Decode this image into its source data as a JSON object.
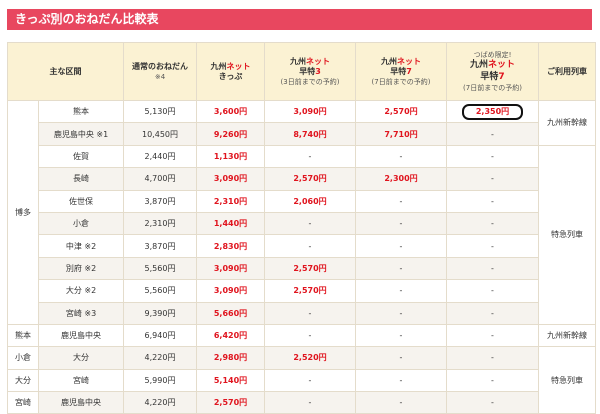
{
  "title": "きっぷ別のおねだん比較表",
  "header": {
    "section": "主な区間",
    "normal": [
      "通常のおねだん",
      "※4"
    ],
    "kyushu_net": [
      "九州",
      "ネット",
      "きっぷ"
    ],
    "haya3": [
      "九州",
      "ネット",
      "早特",
      "3",
      "(3日前までの予約)"
    ],
    "haya7": [
      "九州",
      "ネット",
      "早特",
      "7",
      "(7日前までの予約)"
    ],
    "tsubame": [
      "つばめ限定!",
      "九州",
      "ネット",
      "早特",
      "7",
      "(7日前までの予約)"
    ],
    "train": "ご利用列車"
  },
  "origins": [
    "博多",
    "熊本",
    "小倉",
    "大分",
    "宮崎"
  ],
  "lines": [
    "九州新幹線",
    "特急列車",
    "九州新幹線",
    "特急列車"
  ],
  "rows": [
    {
      "dest": "熊本",
      "normal": "5,130円",
      "net": "3,600円",
      "h3": "3,090円",
      "h7": "2,570円",
      "tsubame": "2,350円"
    },
    {
      "dest": "鹿児島中央 ※1",
      "normal": "10,450円",
      "net": "9,260円",
      "h3": "8,740円",
      "h7": "7,710円",
      "tsubame": "-"
    },
    {
      "dest": "佐賀",
      "normal": "2,440円",
      "net": "1,130円",
      "h3": "-",
      "h7": "-",
      "tsubame": "-"
    },
    {
      "dest": "長崎",
      "normal": "4,700円",
      "net": "3,090円",
      "h3": "2,570円",
      "h7": "2,300円",
      "tsubame": "-"
    },
    {
      "dest": "佐世保",
      "normal": "3,870円",
      "net": "2,310円",
      "h3": "2,060円",
      "h7": "-",
      "tsubame": "-"
    },
    {
      "dest": "小倉",
      "normal": "2,310円",
      "net": "1,440円",
      "h3": "-",
      "h7": "-",
      "tsubame": "-"
    },
    {
      "dest": "中津 ※2",
      "normal": "3,870円",
      "net": "2,830円",
      "h3": "-",
      "h7": "-",
      "tsubame": "-"
    },
    {
      "dest": "別府 ※2",
      "normal": "5,560円",
      "net": "3,090円",
      "h3": "2,570円",
      "h7": "-",
      "tsubame": "-"
    },
    {
      "dest": "大分 ※2",
      "normal": "5,560円",
      "net": "3,090円",
      "h3": "2,570円",
      "h7": "-",
      "tsubame": "-"
    },
    {
      "dest": "宮崎 ※3",
      "normal": "9,390円",
      "net": "5,660円",
      "h3": "-",
      "h7": "-",
      "tsubame": "-"
    },
    {
      "dest": "鹿児島中央",
      "normal": "6,940円",
      "net": "6,420円",
      "h3": "-",
      "h7": "-",
      "tsubame": "-"
    },
    {
      "dest": "大分",
      "normal": "4,220円",
      "net": "2,980円",
      "h3": "2,520円",
      "h7": "-",
      "tsubame": "-"
    },
    {
      "dest": "宮崎",
      "normal": "5,990円",
      "net": "5,140円",
      "h3": "-",
      "h7": "-",
      "tsubame": "-"
    },
    {
      "dest": "鹿児島中央",
      "normal": "4,220円",
      "net": "2,570円",
      "h3": "-",
      "h7": "-",
      "tsubame": "-"
    }
  ]
}
